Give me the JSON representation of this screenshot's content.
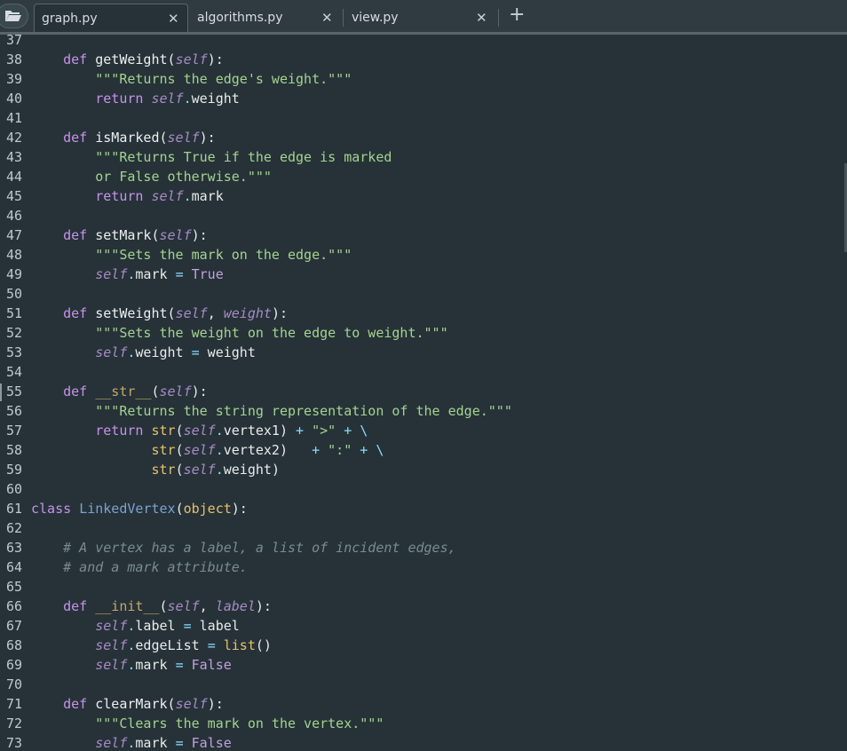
{
  "tabs": [
    {
      "label": "graph.py",
      "active": true
    },
    {
      "label": "algorithms.py",
      "active": false
    },
    {
      "label": "view.py",
      "active": false
    }
  ],
  "icons": {
    "close": "close-icon",
    "new_tab": "plus-icon",
    "folder": "folder-open-icon"
  },
  "colors": {
    "background": "#263238",
    "keyword": "#c792ea",
    "string": "#a5d38f",
    "class_name": "#7aa2d2",
    "builtin": "#e8c06b",
    "comment": "#7c8a91"
  },
  "editor": {
    "lines": [
      {
        "n": "37",
        "tokens": []
      },
      {
        "n": "38",
        "tokens": [
          [
            "pl",
            "    "
          ],
          [
            "kw",
            "def"
          ],
          [
            "pl",
            " "
          ],
          [
            "fn",
            "getWeight"
          ],
          [
            "pa",
            "("
          ],
          [
            "self",
            "self"
          ],
          [
            "pa",
            "):"
          ]
        ]
      },
      {
        "n": "39",
        "tokens": [
          [
            "pl",
            "        "
          ],
          [
            "str",
            "\"\"\"Returns the edge's weight.\"\"\""
          ]
        ]
      },
      {
        "n": "40",
        "tokens": [
          [
            "pl",
            "        "
          ],
          [
            "kw",
            "return"
          ],
          [
            "pl",
            " "
          ],
          [
            "self",
            "self"
          ],
          [
            "op",
            "."
          ],
          [
            "pl",
            "weight"
          ]
        ]
      },
      {
        "n": "41",
        "tokens": []
      },
      {
        "n": "42",
        "tokens": [
          [
            "pl",
            "    "
          ],
          [
            "kw",
            "def"
          ],
          [
            "pl",
            " "
          ],
          [
            "fn",
            "isMarked"
          ],
          [
            "pa",
            "("
          ],
          [
            "self",
            "self"
          ],
          [
            "pa",
            "):"
          ]
        ]
      },
      {
        "n": "43",
        "tokens": [
          [
            "pl",
            "        "
          ],
          [
            "str",
            "\"\"\"Returns True if the edge is marked"
          ]
        ]
      },
      {
        "n": "44",
        "tokens": [
          [
            "pl",
            "        "
          ],
          [
            "str",
            "or False otherwise.\"\"\""
          ]
        ]
      },
      {
        "n": "45",
        "tokens": [
          [
            "pl",
            "        "
          ],
          [
            "kw",
            "return"
          ],
          [
            "pl",
            " "
          ],
          [
            "self",
            "self"
          ],
          [
            "op",
            "."
          ],
          [
            "pl",
            "mark"
          ]
        ]
      },
      {
        "n": "46",
        "tokens": []
      },
      {
        "n": "47",
        "tokens": [
          [
            "pl",
            "    "
          ],
          [
            "kw",
            "def"
          ],
          [
            "pl",
            " "
          ],
          [
            "fn",
            "setMark"
          ],
          [
            "pa",
            "("
          ],
          [
            "self",
            "self"
          ],
          [
            "pa",
            "):"
          ]
        ]
      },
      {
        "n": "48",
        "tokens": [
          [
            "pl",
            "        "
          ],
          [
            "str",
            "\"\"\"Sets the mark on the edge.\"\"\""
          ]
        ]
      },
      {
        "n": "49",
        "tokens": [
          [
            "pl",
            "        "
          ],
          [
            "self",
            "self"
          ],
          [
            "op",
            "."
          ],
          [
            "pl",
            "mark "
          ],
          [
            "op",
            "="
          ],
          [
            "pl",
            " "
          ],
          [
            "kw2",
            "True"
          ]
        ]
      },
      {
        "n": "50",
        "tokens": []
      },
      {
        "n": "51",
        "tokens": [
          [
            "pl",
            "    "
          ],
          [
            "kw",
            "def"
          ],
          [
            "pl",
            " "
          ],
          [
            "fn",
            "setWeight"
          ],
          [
            "pa",
            "("
          ],
          [
            "self",
            "self"
          ],
          [
            "pa",
            ", "
          ],
          [
            "self",
            "weight"
          ],
          [
            "pa",
            "):"
          ]
        ]
      },
      {
        "n": "52",
        "tokens": [
          [
            "pl",
            "        "
          ],
          [
            "str",
            "\"\"\"Sets the weight on the edge to weight.\"\"\""
          ]
        ]
      },
      {
        "n": "53",
        "tokens": [
          [
            "pl",
            "        "
          ],
          [
            "self",
            "self"
          ],
          [
            "op",
            "."
          ],
          [
            "pl",
            "weight "
          ],
          [
            "op",
            "="
          ],
          [
            "pl",
            " weight"
          ]
        ]
      },
      {
        "n": "54",
        "tokens": []
      },
      {
        "n": "55",
        "tokens": [
          [
            "pl",
            "    "
          ],
          [
            "kw",
            "def"
          ],
          [
            "pl",
            " "
          ],
          [
            "dun",
            "__str__"
          ],
          [
            "pa",
            "("
          ],
          [
            "self",
            "self"
          ],
          [
            "pa",
            "):"
          ]
        ]
      },
      {
        "n": "56",
        "tokens": [
          [
            "pl",
            "        "
          ],
          [
            "str",
            "\"\"\"Returns the string representation of the edge.\"\"\""
          ]
        ]
      },
      {
        "n": "57",
        "tokens": [
          [
            "pl",
            "        "
          ],
          [
            "kw",
            "return"
          ],
          [
            "pl",
            " "
          ],
          [
            "bi",
            "str"
          ],
          [
            "pa",
            "("
          ],
          [
            "self",
            "self"
          ],
          [
            "op",
            "."
          ],
          [
            "pl",
            "vertex1"
          ],
          [
            "pa",
            ")"
          ],
          [
            "pl",
            " "
          ],
          [
            "op",
            "+"
          ],
          [
            "pl",
            " "
          ],
          [
            "str",
            "\">\""
          ],
          [
            "pl",
            " "
          ],
          [
            "op",
            "+"
          ],
          [
            "pl",
            " "
          ],
          [
            "op",
            "\\"
          ]
        ]
      },
      {
        "n": "58",
        "tokens": [
          [
            "pl",
            "               "
          ],
          [
            "bi",
            "str"
          ],
          [
            "pa",
            "("
          ],
          [
            "self",
            "self"
          ],
          [
            "op",
            "."
          ],
          [
            "pl",
            "vertex2"
          ],
          [
            "pa",
            ")"
          ],
          [
            "pl",
            "   "
          ],
          [
            "op",
            "+"
          ],
          [
            "pl",
            " "
          ],
          [
            "str",
            "\":\""
          ],
          [
            "pl",
            " "
          ],
          [
            "op",
            "+"
          ],
          [
            "pl",
            " "
          ],
          [
            "op",
            "\\"
          ]
        ]
      },
      {
        "n": "59",
        "tokens": [
          [
            "pl",
            "               "
          ],
          [
            "bi",
            "str"
          ],
          [
            "pa",
            "("
          ],
          [
            "self",
            "self"
          ],
          [
            "op",
            "."
          ],
          [
            "pl",
            "weight"
          ],
          [
            "pa",
            ")"
          ]
        ]
      },
      {
        "n": "60",
        "tokens": []
      },
      {
        "n": "61",
        "tokens": [
          [
            "kw",
            "class"
          ],
          [
            "pl",
            " "
          ],
          [
            "cls",
            "LinkedVertex"
          ],
          [
            "pa",
            "("
          ],
          [
            "bi",
            "object"
          ],
          [
            "pa",
            "):"
          ]
        ]
      },
      {
        "n": "62",
        "tokens": []
      },
      {
        "n": "63",
        "tokens": [
          [
            "pl",
            "    "
          ],
          [
            "cm",
            "# A vertex has a label, a list of incident edges,"
          ]
        ]
      },
      {
        "n": "64",
        "tokens": [
          [
            "pl",
            "    "
          ],
          [
            "cm",
            "# and a mark attribute."
          ]
        ]
      },
      {
        "n": "65",
        "tokens": []
      },
      {
        "n": "66",
        "tokens": [
          [
            "pl",
            "    "
          ],
          [
            "kw",
            "def"
          ],
          [
            "pl",
            " "
          ],
          [
            "dun",
            "__init__"
          ],
          [
            "pa",
            "("
          ],
          [
            "self",
            "self"
          ],
          [
            "pa",
            ", "
          ],
          [
            "self",
            "label"
          ],
          [
            "pa",
            "):"
          ]
        ]
      },
      {
        "n": "67",
        "tokens": [
          [
            "pl",
            "        "
          ],
          [
            "self",
            "self"
          ],
          [
            "op",
            "."
          ],
          [
            "pl",
            "label "
          ],
          [
            "op",
            "="
          ],
          [
            "pl",
            " label"
          ]
        ]
      },
      {
        "n": "68",
        "tokens": [
          [
            "pl",
            "        "
          ],
          [
            "self",
            "self"
          ],
          [
            "op",
            "."
          ],
          [
            "pl",
            "edgeList "
          ],
          [
            "op",
            "="
          ],
          [
            "pl",
            " "
          ],
          [
            "bi",
            "list"
          ],
          [
            "pa",
            "()"
          ]
        ]
      },
      {
        "n": "69",
        "tokens": [
          [
            "pl",
            "        "
          ],
          [
            "self",
            "self"
          ],
          [
            "op",
            "."
          ],
          [
            "pl",
            "mark "
          ],
          [
            "op",
            "="
          ],
          [
            "pl",
            " "
          ],
          [
            "kw2",
            "False"
          ]
        ]
      },
      {
        "n": "70",
        "tokens": []
      },
      {
        "n": "71",
        "tokens": [
          [
            "pl",
            "    "
          ],
          [
            "kw",
            "def"
          ],
          [
            "pl",
            " "
          ],
          [
            "fn",
            "clearMark"
          ],
          [
            "pa",
            "("
          ],
          [
            "self",
            "self"
          ],
          [
            "pa",
            "):"
          ]
        ]
      },
      {
        "n": "72",
        "tokens": [
          [
            "pl",
            "        "
          ],
          [
            "str",
            "\"\"\"Clears the mark on the vertex.\"\"\""
          ]
        ]
      },
      {
        "n": "73",
        "tokens": [
          [
            "pl",
            "        "
          ],
          [
            "self",
            "self"
          ],
          [
            "op",
            "."
          ],
          [
            "pl",
            "mark "
          ],
          [
            "op",
            "="
          ],
          [
            "pl",
            " "
          ],
          [
            "kw2",
            "False"
          ]
        ]
      }
    ]
  }
}
